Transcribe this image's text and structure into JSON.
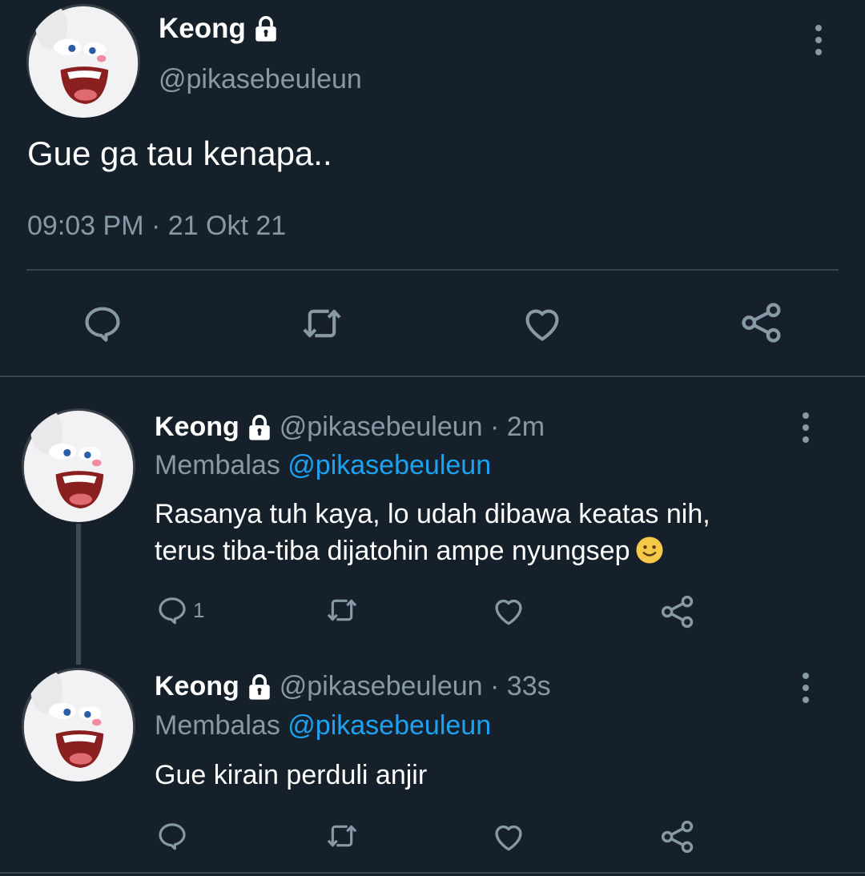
{
  "colors": {
    "background": "#15202b",
    "divider": "#38444d",
    "secondary_text": "#8899a6",
    "link": "#1da1f2"
  },
  "main_tweet": {
    "name": "Keong",
    "handle": "@pikasebeuleun",
    "text": "Gue ga tau kenapa..",
    "timestamp": "09:03 PM · 21 Okt 21",
    "verified_icon": "lock-icon",
    "actions": [
      "reply-icon",
      "retweet-icon",
      "like-icon",
      "share-icon"
    ]
  },
  "replies": [
    {
      "name": "Keong",
      "handle_time": "@pikasebeuleun · 2m",
      "replying_label": "Membalas",
      "replying_to": "@pikasebeuleun",
      "text_line1": "Rasanya tuh kaya, lo udah dibawa keatas nih,",
      "text_line2": "terus tiba-tiba dijatohin ampe nyungsep",
      "emoji": "slightly-smiling-face",
      "reply_count": "1"
    },
    {
      "name": "Keong",
      "handle_time": "@pikasebeuleun · 33s",
      "replying_label": "Membalas",
      "replying_to": "@pikasebeuleun",
      "text_line1": "Gue kirain perduli anjir",
      "reply_count": ""
    }
  ]
}
